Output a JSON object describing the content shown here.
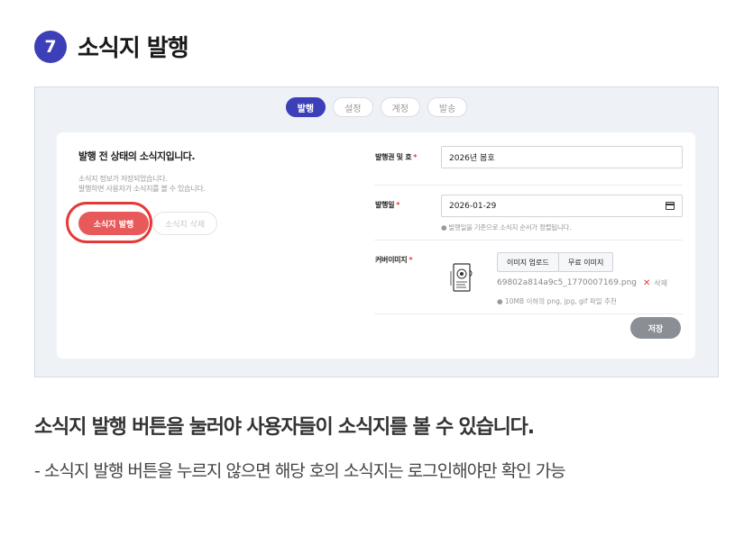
{
  "step": {
    "number": "7",
    "title": "소식지 발행"
  },
  "tabs": [
    {
      "label": "발행",
      "active": true
    },
    {
      "label": "설정",
      "active": false
    },
    {
      "label": "계정",
      "active": false
    },
    {
      "label": "발송",
      "active": false
    }
  ],
  "status": {
    "title": "발행 전 상태의 소식지입니다.",
    "desc1": "소식지 정보가 저장되었습니다.",
    "desc2": "발행하면 사용자가 소식지를 볼 수 있습니다.",
    "publish_label": "소식지 발행",
    "delete_label": "소식지 삭제"
  },
  "form": {
    "issue_label": "발행권 및 호",
    "issue_value": "2026년 봄호",
    "date_label": "발행일",
    "date_value": "2026-01-29",
    "date_hint": "● 발행일을 기준으로 소식지 순서가 정렬됩니다.",
    "cover_label": "커버이미지",
    "upload_label": "이미지 업로드",
    "free_image_label": "무료 이미지",
    "file_name": "69802a814a9c5_1770007169.png",
    "file_delete_label": "삭제",
    "file_hint": "● 10MB 이하의 png, jpg, gif 파일 추천",
    "required_mark": "*",
    "save_label": "저장"
  },
  "caption": {
    "main": "소식지 발행 버튼을 눌러야 사용자들이 소식지를 볼 수 있습니다.",
    "sub": "- 소식지 발행 버튼을 누르지 않으면 해당 호의 소식지는 로그인해야만 확인 가능"
  },
  "colors": {
    "accent": "#3d3fb8",
    "publish": "#e85a5a",
    "highlight": "#e53935",
    "save": "#8a8f96"
  },
  "icons": {
    "calendar": "calendar-icon",
    "delete": "close-icon",
    "cover": "journal-thumbnail"
  }
}
